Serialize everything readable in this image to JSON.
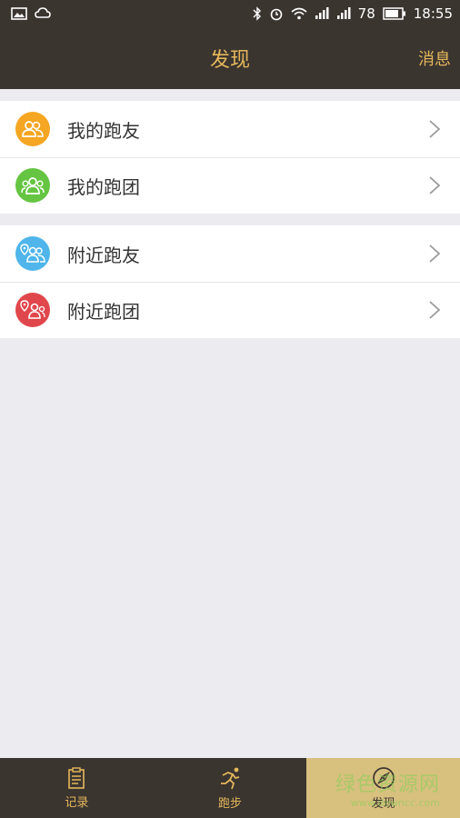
{
  "status_bar": {
    "battery": "78",
    "time": "18:55"
  },
  "header": {
    "title": "发现",
    "action": "消息"
  },
  "groups": [
    {
      "items": [
        {
          "label": "我的跑友",
          "icon": "friends-icon",
          "color": "#f5a623"
        },
        {
          "label": "我的跑团",
          "icon": "group-icon",
          "color": "#65c542"
        }
      ]
    },
    {
      "items": [
        {
          "label": "附近跑友",
          "icon": "nearby-friends-icon",
          "color": "#4fb5ea"
        },
        {
          "label": "附近跑团",
          "icon": "nearby-group-icon",
          "color": "#e0474c"
        }
      ]
    }
  ],
  "tabbar": {
    "tabs": [
      {
        "label": "记录",
        "icon": "clipboard-icon",
        "active": false
      },
      {
        "label": "跑步",
        "icon": "runner-icon",
        "active": false
      },
      {
        "label": "发现",
        "icon": "compass-icon",
        "active": true
      }
    ]
  },
  "watermark": {
    "text": "绿色资源网",
    "url": "www.downcc.com"
  },
  "colors": {
    "dark": "#3b3530",
    "gold": "#e5b75a",
    "active_tab": "#d8c07e"
  }
}
